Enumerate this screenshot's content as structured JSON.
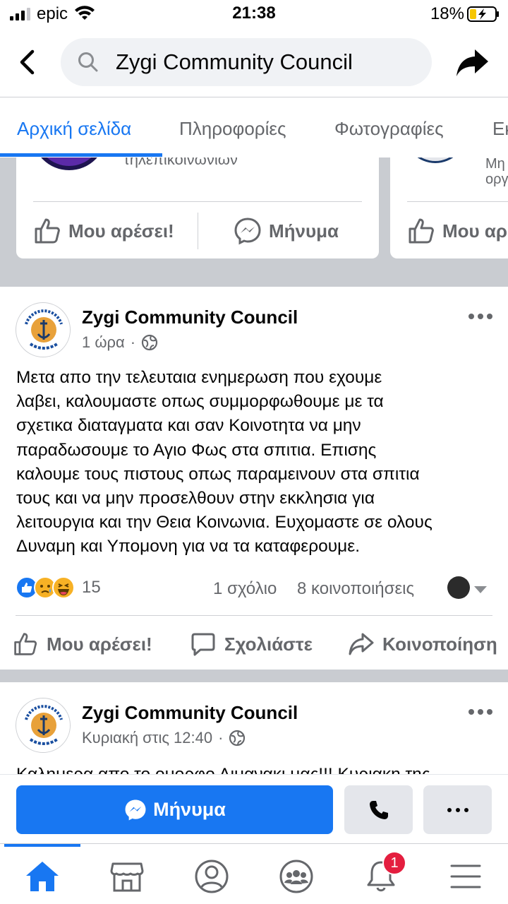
{
  "status_bar": {
    "carrier": "epic",
    "time": "21:38",
    "battery_percent": "18%"
  },
  "header": {
    "search_value": "Zygi Community Council"
  },
  "tabs": [
    {
      "label": "Αρχική σελίδα",
      "active": true
    },
    {
      "label": "Πληροφορίες",
      "active": false
    },
    {
      "label": "Φωτογραφίες",
      "active": false
    },
    {
      "label": "Εκ",
      "active": false
    }
  ],
  "related_pages": {
    "card1_subtitle": "τηλεπικοινωνιών",
    "card1_like": "Μου αρέσει!",
    "card1_message": "Μήνυμα",
    "card2_subtitle_line1": "Μη",
    "card2_subtitle_line2": "οργ",
    "card2_like": "Μου αρ"
  },
  "post1": {
    "page_name": "Zygi Community Council",
    "time": "1 ώρα",
    "text": "Μετα απο την τελευταια ενημερωση που εχουμε\nλαβει, καλουμαστε οπως συμμορφωθουμε με τα\nσχετικα διαταγματα και σαν Κοινοτητα να μην\nπαραδωσουμε το Αγιο Φως στα σπιτια. Επισης\nκαλουμε τους πιστους οπως παραμεινουν στα σπιτια\nτους και να μην προσελθουν στην εκκλησια για\nλειτουργια και την Θεια Κοινωνια. Ευχομαστε σε ολους\nΔυναμη και Υπομονη για να τα καταφερουμε.",
    "reaction_count": "15",
    "comments": "1 σχόλιο",
    "shares": "8 κοινοποιήσεις",
    "like_label": "Μου αρέσει!",
    "comment_label": "Σχολιάστε",
    "share_label": "Κοινοποίηση"
  },
  "post2": {
    "page_name": "Zygi Community Council",
    "time": "Κυριακή στις 12:40",
    "text_partial": "Καλημερα απο το ομορφο Λιμανακι μας!!! Κυριακη της"
  },
  "action_bar": {
    "message_label": "Μήνυμα"
  },
  "bottom_nav": {
    "notification_badge": "1"
  },
  "colors": {
    "accent": "#1877f2",
    "badge": "#e41e3f",
    "secondary_text": "#65676b"
  }
}
